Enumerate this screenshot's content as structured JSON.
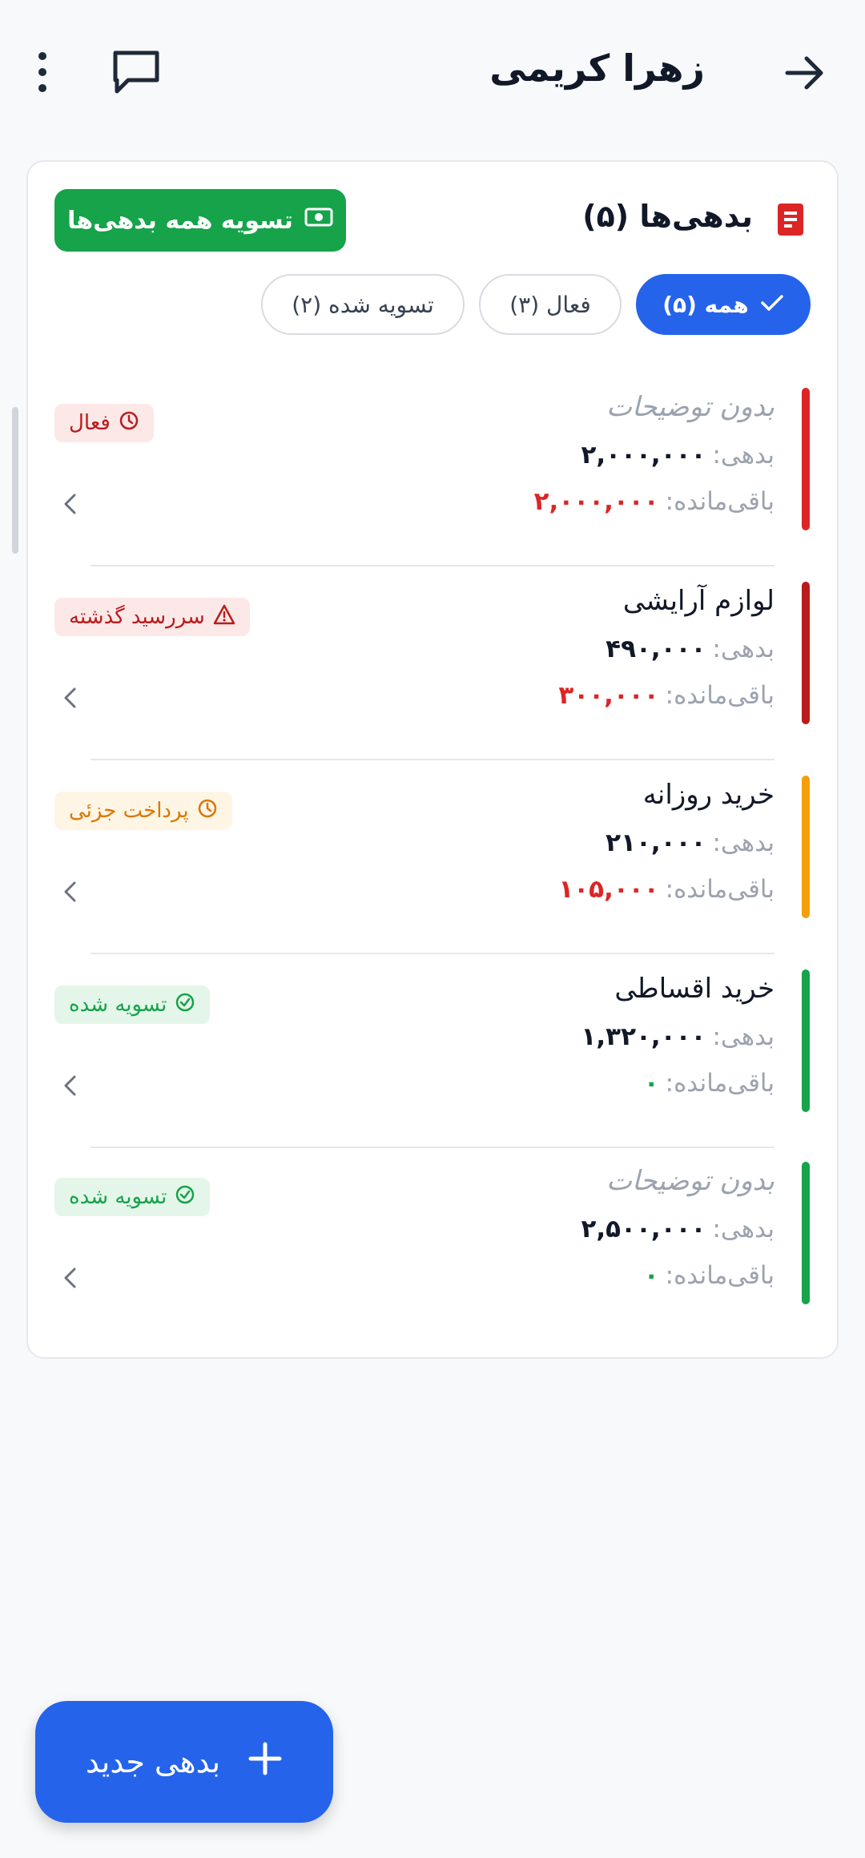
{
  "header": {
    "title": "زهرا کریمی"
  },
  "card": {
    "title": "بدهی‌ها (۵)",
    "settle_all_label": "تسویه همه بدهی‌ها"
  },
  "filters": [
    {
      "label": "همه (۵)",
      "active": true
    },
    {
      "label": "فعال (۳)",
      "active": false
    },
    {
      "label": "تسویه شده (۲)",
      "active": false
    }
  ],
  "labels": {
    "debt": "بدهی:",
    "remaining": "باقی‌مانده:"
  },
  "items": [
    {
      "description": "بدون توضیحات",
      "debt": "۲,۰۰۰,۰۰۰",
      "remaining": "۲,۰۰۰,۰۰۰",
      "status": "فعال",
      "bar_color": "#dc2626"
    },
    {
      "description": "لوازم آرایشی",
      "debt": "۴۹۰,۰۰۰",
      "remaining": "۳۰۰,۰۰۰",
      "status": "سررسید گذشته",
      "bar_color": "#b91c1c"
    },
    {
      "description": "خرید روزانه",
      "debt": "۲۱۰,۰۰۰",
      "remaining": "۱۰۵,۰۰۰",
      "status": "پرداخت جزئی",
      "bar_color": "#f59e0b"
    },
    {
      "description": "خرید اقساطی",
      "debt": "۱,۳۲۰,۰۰۰",
      "remaining": "۰",
      "status": "تسویه شده",
      "bar_color": "#16a34a"
    },
    {
      "description": "بدون توضیحات",
      "debt": "۲,۵۰۰,۰۰۰",
      "remaining": "۰",
      "status": "تسویه شده",
      "bar_color": "#16a34a"
    }
  ],
  "fab": {
    "label": "بدهی جدید"
  },
  "colors": {
    "primary": "#2563eb",
    "success": "#16a34a",
    "danger": "#dc2626",
    "warning": "#f59e0b"
  }
}
